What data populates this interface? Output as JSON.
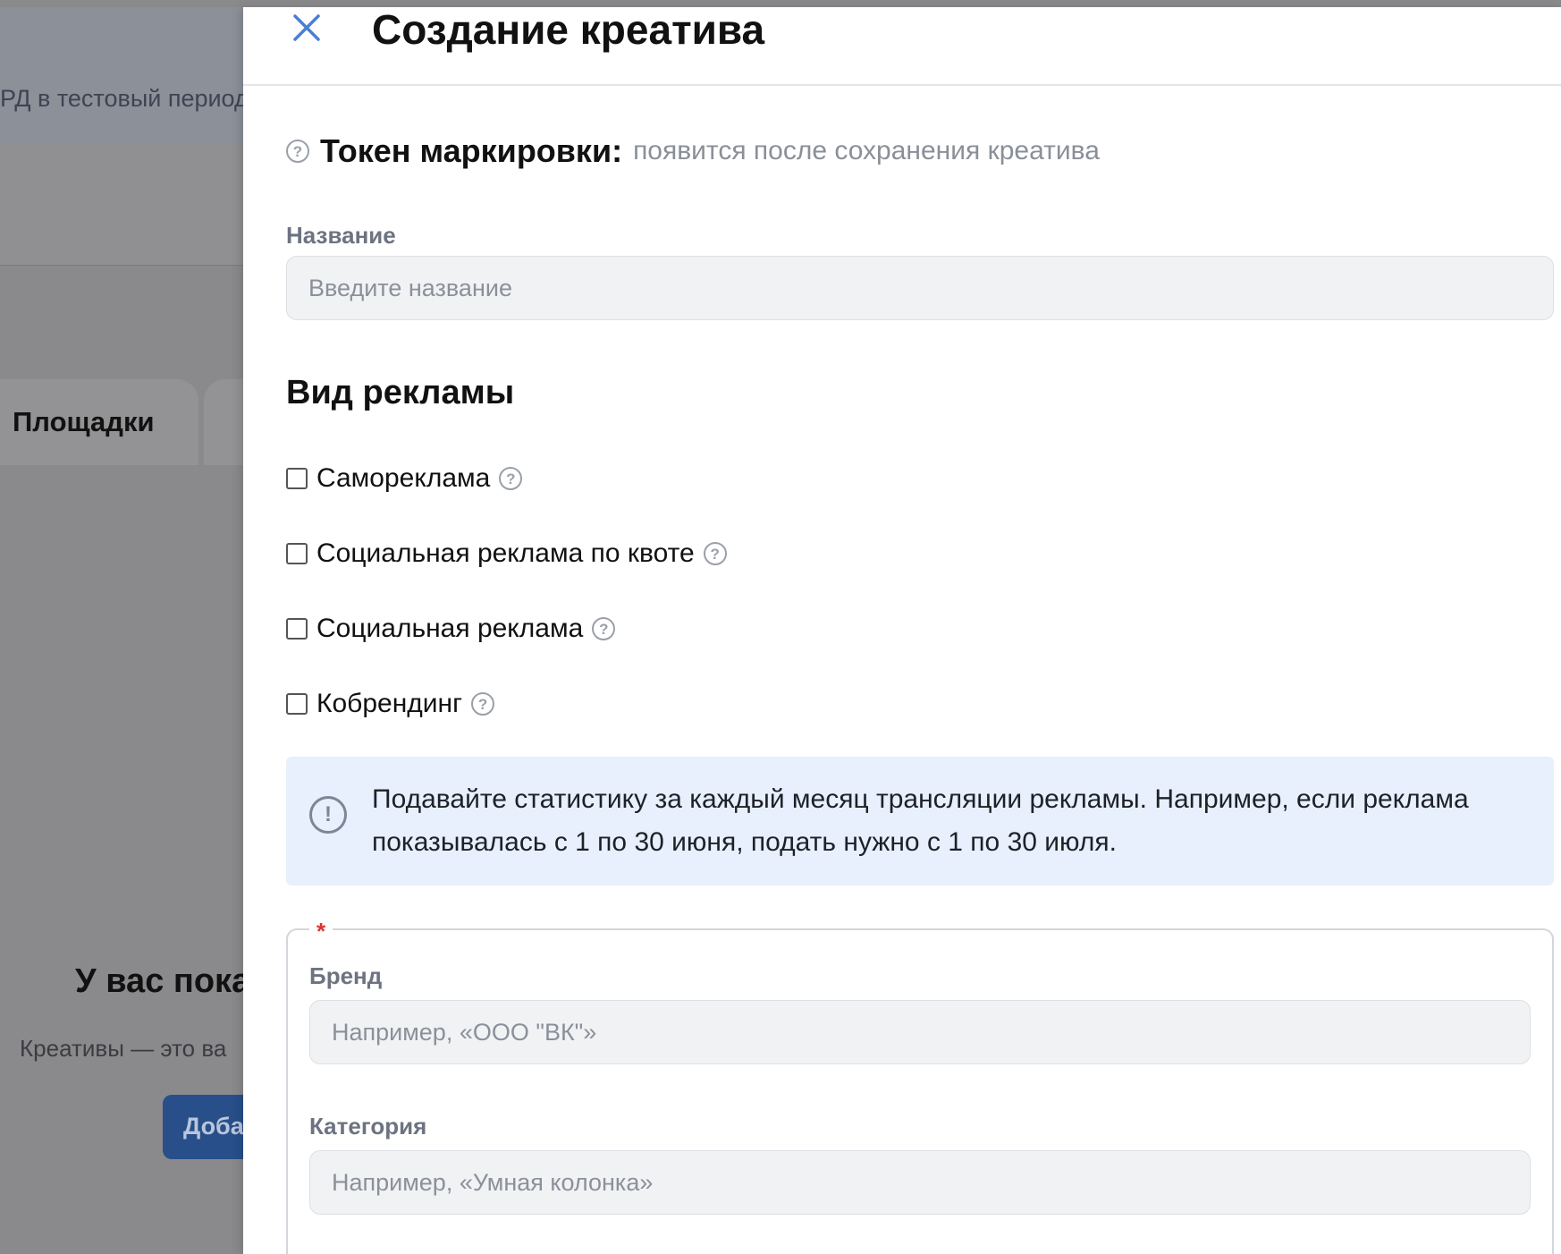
{
  "background": {
    "banner_text": "РД в тестовый период",
    "tab_label": "Площадки",
    "empty_title": "У вас пока",
    "empty_subtitle": "Креативы — это ва",
    "add_button_label": "Доба"
  },
  "panel": {
    "title": "Создание креатива",
    "token": {
      "label": "Токен маркировки:",
      "value": "появится после сохранения креатива"
    },
    "name_field": {
      "label": "Название",
      "placeholder": "Введите название",
      "value": ""
    },
    "ad_type": {
      "title": "Вид рекламы",
      "options": [
        {
          "label": "Самореклама",
          "checked": false
        },
        {
          "label": "Социальная реклама по квоте",
          "checked": false
        },
        {
          "label": "Социальная реклама",
          "checked": false
        },
        {
          "label": "Кобрендинг",
          "checked": false
        }
      ]
    },
    "info": {
      "text": "Подавайте статистику за каждый месяц трансляции рекламы. Например, если реклама показывалась с 1 по 30 июня, подать нужно с 1 по 30 июля."
    },
    "product_group": {
      "required_mark": "*",
      "brand": {
        "label": "Бренд",
        "placeholder": "Например, «ООО \"ВК\"»",
        "value": ""
      },
      "category": {
        "label": "Категория",
        "placeholder": "Например, «Умная колонка»",
        "value": ""
      }
    }
  },
  "colors": {
    "accent": "#4a7fd4",
    "info_bg": "#e7f0fc",
    "required": "#dd3333"
  }
}
